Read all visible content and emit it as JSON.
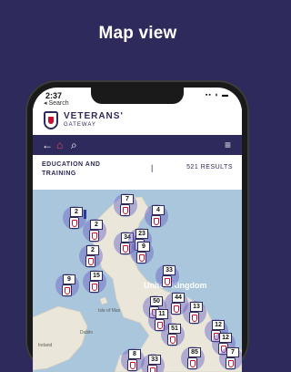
{
  "promo": {
    "title": "Map view"
  },
  "status": {
    "time": "2:37",
    "back": "◂ Search",
    "icons": "▪▪ ◗ ▬"
  },
  "brand": {
    "name": "VETERANS'",
    "sub": "GATEWAY"
  },
  "nav": {
    "back": "←",
    "home": "⌂",
    "search": "⌕",
    "menu": "≡"
  },
  "filter": {
    "label": "EDUCATION AND TRAINING",
    "separator": "|",
    "results": "521 RESULTS"
  },
  "map": {
    "labels": {
      "country": "United Kingdom",
      "isle": "Isle of Man",
      "ireland": "Ireland",
      "dublin": "Dublin"
    },
    "clusters": [
      {
        "count": "2"
      },
      {
        "count": "7"
      },
      {
        "count": "4"
      },
      {
        "count": "2"
      },
      {
        "count": "34"
      },
      {
        "count": "23"
      },
      {
        "count": "2"
      },
      {
        "count": "9"
      },
      {
        "count": "9"
      },
      {
        "count": "15"
      },
      {
        "count": "33"
      },
      {
        "count": "50"
      },
      {
        "count": "44"
      },
      {
        "count": "13"
      },
      {
        "count": "11"
      },
      {
        "count": "12"
      },
      {
        "count": "51"
      },
      {
        "count": "12"
      },
      {
        "count": "8"
      },
      {
        "count": "33"
      },
      {
        "count": "85"
      },
      {
        "count": "7"
      }
    ]
  }
}
